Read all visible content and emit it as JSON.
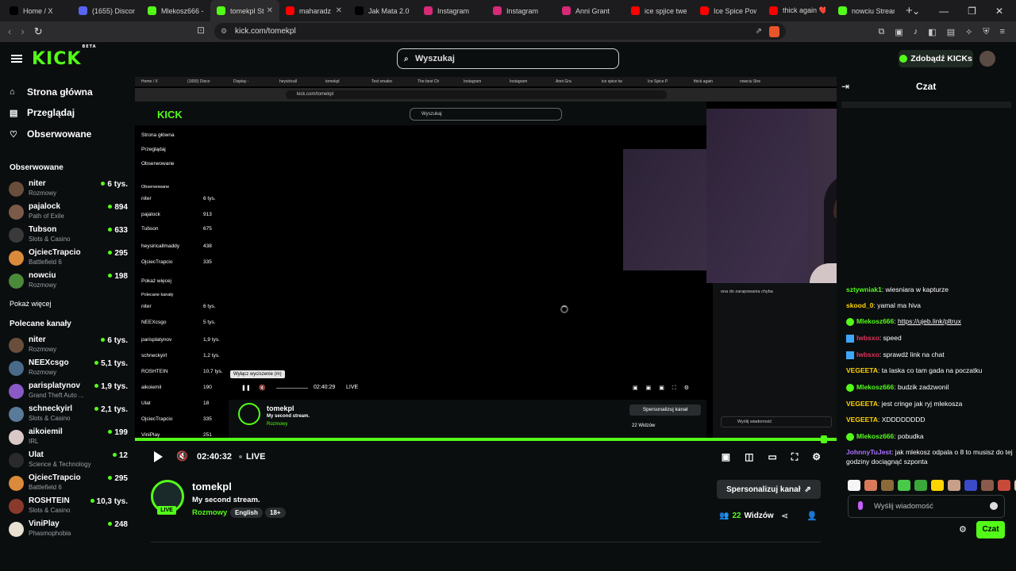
{
  "browser": {
    "tabs": [
      {
        "label": "Home / X",
        "icon": "x-icon",
        "color": "#000000"
      },
      {
        "label": "(1655) Discord",
        "icon": "discord-icon",
        "color": "#5865f2"
      },
      {
        "label": "Mlekosz666 - ",
        "icon": "kick-icon",
        "color": "#53fc18"
      },
      {
        "label": "tomekpl St",
        "icon": "kick-icon",
        "color": "#53fc18"
      },
      {
        "label": "maharadz",
        "icon": "youtube-icon",
        "color": "#ff0000"
      },
      {
        "label": "Jak Mata 2.0 ",
        "icon": "tiktok-icon",
        "color": "#000000"
      },
      {
        "label": "Instagram",
        "icon": "instagram-icon",
        "color": "#d62976"
      },
      {
        "label": "Instagram",
        "icon": "instagram-icon",
        "color": "#d62976"
      },
      {
        "label": "Anni Grant",
        "icon": "instagram-icon",
        "color": "#d62976"
      },
      {
        "label": "ice spjice twerl",
        "icon": "youtube-icon",
        "color": "#ff0000"
      },
      {
        "label": "Ice Spice Powe",
        "icon": "youtube-icon",
        "color": "#ff0000"
      },
      {
        "label": "thick again ❤️",
        "icon": "youtube-icon",
        "color": "#ff0000"
      },
      {
        "label": "nowciu Stream",
        "icon": "kick-icon",
        "color": "#53fc18"
      }
    ],
    "url": "kick.com/tomekpl"
  },
  "header": {
    "logo": "KICK",
    "logo_badge": "BETA",
    "search_placeholder": "Wyszukaj",
    "get_kicks": "Zdobądź KICKs"
  },
  "sidebar": {
    "nav": [
      {
        "label": "Strona główna",
        "icon": "home-icon"
      },
      {
        "label": "Przeglądaj",
        "icon": "browse-icon"
      },
      {
        "label": "Obserwowane",
        "icon": "heart-icon"
      }
    ],
    "following_title": "Obserwowane",
    "following": [
      {
        "name": "niter",
        "category": "Rozmowy",
        "viewers": "6 tys.",
        "color": "#6a4e3c"
      },
      {
        "name": "pajalock",
        "category": "Path of Exile",
        "viewers": "894",
        "color": "#7a5a48"
      },
      {
        "name": "Tubson",
        "category": "Slots & Casino",
        "viewers": "633",
        "color": "#3a3a3a"
      },
      {
        "name": "OjciecTrapcio",
        "category": "Battlefield 6",
        "viewers": "295",
        "color": "#d98a3a"
      },
      {
        "name": "nowciu",
        "category": "Rozmowy",
        "viewers": "198",
        "color": "#4a8a3a"
      }
    ],
    "show_more": "Pokaż więcej",
    "recommended_title": "Polecane kanały",
    "recommended": [
      {
        "name": "niter",
        "category": "Rozmowy",
        "viewers": "6 tys.",
        "color": "#6a4e3c"
      },
      {
        "name": "NEEXcsgo",
        "category": "Rozmowy",
        "viewers": "5,1 tys.",
        "color": "#4a6a8a"
      },
      {
        "name": "parisplatynov",
        "category": "Grand Theft Auto ...",
        "viewers": "1,9 tys.",
        "color": "#8a5ac8"
      },
      {
        "name": "schneckyirl",
        "category": "Slots & Casino",
        "viewers": "2,1 tys.",
        "color": "#5a7a9a"
      },
      {
        "name": "aikoiemil",
        "category": "IRL",
        "viewers": "199",
        "color": "#d8c8c8"
      },
      {
        "name": "Ulat",
        "category": "Science & Technology",
        "viewers": "12",
        "color": "#2a2a2a"
      },
      {
        "name": "OjciecTrapcio",
        "category": "Battlefield 6",
        "viewers": "295",
        "color": "#d98a3a"
      },
      {
        "name": "ROSHTEIN",
        "category": "Slots & Casino",
        "viewers": "10,3 tys.",
        "color": "#8a3a2a"
      },
      {
        "name": "ViniPlay",
        "category": "Phasmophobia",
        "viewers": "248",
        "color": "#e8e0d0"
      }
    ]
  },
  "inner_capture": {
    "url": "kick.com/tomekpl",
    "search": "Wyszukaj",
    "tooltip": "Wyłącz wyciszenie (m)",
    "time": "02:40:29",
    "live": "LIVE",
    "chat_line": "ona do zarapowania chyba",
    "chat_input": "Wyślij wiadomość",
    "sidebar_lines": [
      "Strona główna",
      "Przeglądaj",
      "Obserwowane",
      "Obserwowane",
      "niter",
      "pajalock",
      "Tubson",
      "heysiricallmaddy",
      "OjciecTrapcio",
      "Pokaż więcej",
      "Polecane kanały",
      "niter",
      "NEEXcsgo",
      "parisplatynov",
      "schneckyirl",
      "ROSHTEIN",
      "aikoiemil",
      "Ulat",
      "OjciecTrapcio",
      "ViniPlay"
    ],
    "sidebar_counts": [
      "6 tys.",
      "913",
      "675",
      "438",
      "335",
      "6 tys.",
      "5 tys.",
      "1,9 tys.",
      "1,2 tys.",
      "10,7 tys.",
      "190",
      "18",
      "335",
      "251"
    ],
    "tabs": [
      "Home / X",
      "(1655) Disco",
      "Display -",
      "heysiricall",
      "tomekpl",
      "Text smalec",
      "The best Ch",
      "Instagram",
      "Instagram",
      "Anni Gra",
      "ice spice tw",
      "Ice Spice P",
      "thick again",
      "nowciu Stre"
    ]
  },
  "player": {
    "time": "02:40:32",
    "live": "LIVE"
  },
  "stream": {
    "streamer": "tomekpl",
    "title": "My second stream.",
    "category": "Rozmowy",
    "tags": [
      "English",
      "18+"
    ],
    "live_label": "LIVE",
    "customize": "Spersonalizuj kanał",
    "viewers_count": "22",
    "viewers_label": "Widzów"
  },
  "chat": {
    "title": "Czat",
    "messages": [
      {
        "user": "sztywniak1",
        "color": "#53fc18",
        "badge": "",
        "text": "wiesniara w kapturze"
      },
      {
        "user": "skood_0",
        "color": "#ffd400",
        "badge": "",
        "text": "yamal ma hiva"
      },
      {
        "user": "Mlekosz666",
        "color": "#53fc18",
        "badge": "green",
        "text": "https://ujeb.link/pltrux"
      },
      {
        "user": "Iwbsxo",
        "color": "#e0335c",
        "badge": "blue",
        "text": "speed"
      },
      {
        "user": "Iwbsxo",
        "color": "#e0335c",
        "badge": "blue",
        "text": "sprawdź link na chat"
      },
      {
        "user": "VEGEETA",
        "color": "#ffd400",
        "badge": "",
        "text": "ta laska co tam gada na poczatku"
      },
      {
        "user": "Mlekosz666",
        "color": "#53fc18",
        "badge": "green",
        "text": "budzik zadzwonil"
      },
      {
        "user": "VEGEETA",
        "color": "#ffd400",
        "badge": "",
        "text": "jest cringe jak ryj mlekosza"
      },
      {
        "user": "VEGEETA",
        "color": "#ffd400",
        "badge": "",
        "text": "XDDDDDDDD"
      },
      {
        "user": "Mlekosz666",
        "color": "#53fc18",
        "badge": "green",
        "text": "pobudka"
      },
      {
        "user": "JohnnyTuJest",
        "color": "#a970ff",
        "badge": "",
        "text": "jak mlekosz odpala o 8 to musisz do tej godziny dociągnąć szponta"
      }
    ],
    "input_placeholder": "Wyślij wiadomość",
    "send": "Czat"
  }
}
